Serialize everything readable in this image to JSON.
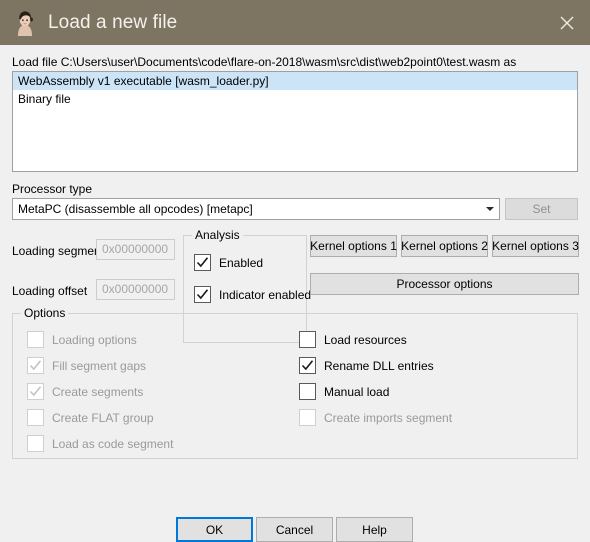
{
  "window": {
    "title": "Load a new file",
    "icon": "ida-lady-icon",
    "close_label": "✕",
    "titlebar_color": "#7d7462",
    "background_color": "#f0f0f0"
  },
  "loadfile": {
    "label": "Load file C:\\Users\\user\\Documents\\code\\flare-on-2018\\wasm\\src\\dist\\web2point0\\test.wasm as",
    "items": [
      {
        "label": "WebAssembly v1 executable [wasm_loader.py]",
        "selected": true
      },
      {
        "label": "Binary file",
        "selected": false
      }
    ],
    "selection_color": "#cce4f7"
  },
  "processor": {
    "label": "Processor type",
    "value": "MetaPC (disassemble all opcodes) [metapc]",
    "arrow_icon": "chevron-down-icon",
    "set_label": "Set",
    "set_enabled": false
  },
  "loading": {
    "segment_label": "Loading segment",
    "segment_value": "0x00000000",
    "offset_label": "Loading offset",
    "offset_value": "0x00000000"
  },
  "analysis": {
    "title": "Analysis",
    "items": [
      {
        "label": "Enabled",
        "checked": true,
        "enabled": true
      },
      {
        "label": "Indicator enabled",
        "checked": true,
        "enabled": true
      }
    ]
  },
  "kernel_buttons": {
    "k1": "Kernel options 1",
    "k2": "Kernel options 2",
    "k3": "Kernel options 3",
    "processor_options": "Processor options"
  },
  "options": {
    "title": "Options",
    "left": [
      {
        "label": "Loading options",
        "checked": false,
        "enabled": false
      },
      {
        "label": "Fill segment gaps",
        "checked": true,
        "enabled": false
      },
      {
        "label": "Create segments",
        "checked": true,
        "enabled": false
      },
      {
        "label": "Create FLAT group",
        "checked": false,
        "enabled": false
      },
      {
        "label": "Load as code segment",
        "checked": false,
        "enabled": false
      }
    ],
    "right": [
      {
        "label": "Load resources",
        "checked": false,
        "enabled": true
      },
      {
        "label": "Rename DLL entries",
        "checked": true,
        "enabled": true
      },
      {
        "label": "Manual load",
        "checked": false,
        "enabled": true
      },
      {
        "label": "Create imports segment",
        "checked": false,
        "enabled": false
      }
    ]
  },
  "footer": {
    "ok": "OK",
    "cancel": "Cancel",
    "help": "Help",
    "focus_color": "#0078d7"
  }
}
